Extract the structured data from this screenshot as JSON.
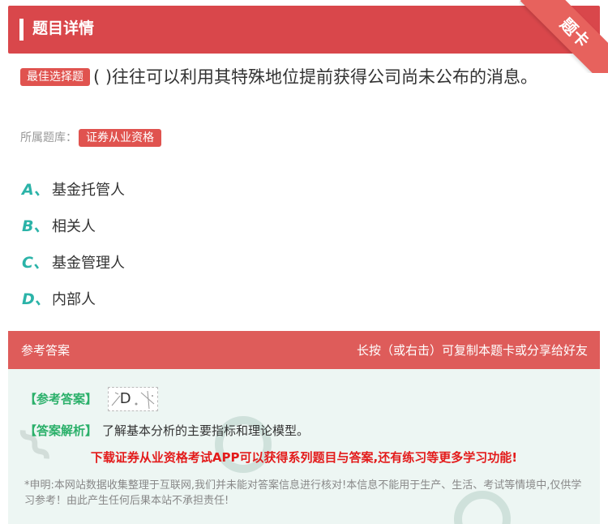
{
  "header": {
    "title": "题目详情"
  },
  "ribbon": {
    "label": "题卡"
  },
  "question": {
    "tag": "最佳选择题",
    "text": "( )往往可以利用其特殊地位提前获得公司尚未公布的消息。"
  },
  "bank": {
    "label": "所属题库：",
    "name": "证券从业资格"
  },
  "options": [
    {
      "letter": "A、",
      "text": "基金托管人"
    },
    {
      "letter": "B、",
      "text": "相关人"
    },
    {
      "letter": "C、",
      "text": "基金管理人"
    },
    {
      "letter": "D、",
      "text": "内部人"
    }
  ],
  "answer_section": {
    "title": "参考答案",
    "share_hint": "长按（或右击）可复制本题卡或分享给好友",
    "answer_label": "【参考答案】",
    "answer_value": "D",
    "analysis_label": "【答案解析】",
    "analysis_text": "了解基本分析的主要指标和理论模型。",
    "promo": "下载证券从业资格考试APP可以获得系列题目与答案,还有练习等更多学习功能!",
    "disclaimer": "*申明:本网站数据收集整理于互联网,我们并未能对答案信息进行核对!本信息不能用于生产、生活、考试等情境中,仅供学习参考！由此产生任何后果本站不承担责任!"
  },
  "colors": {
    "header_red": "#d9474b",
    "option_letter": "#2bb3a8",
    "answer_green": "#2bb06a",
    "promo_red": "#e31b1b"
  }
}
